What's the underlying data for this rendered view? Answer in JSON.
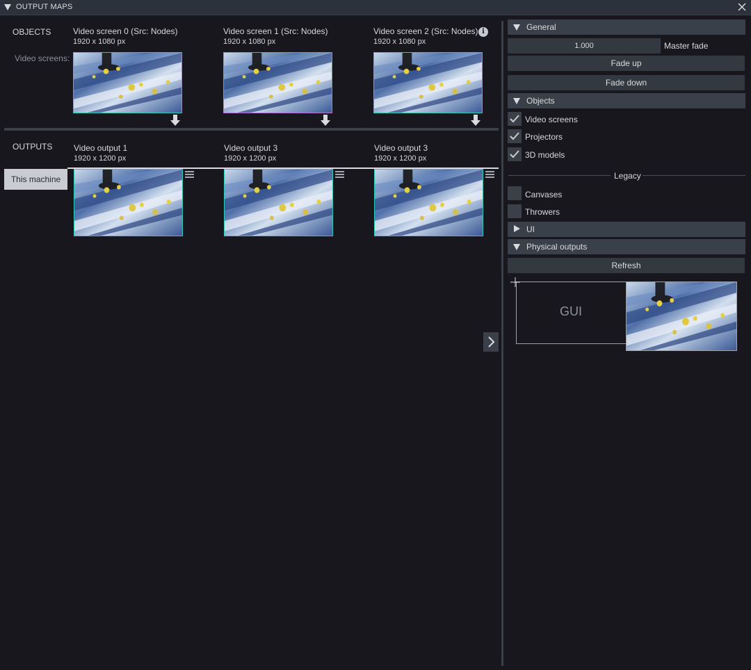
{
  "window": {
    "title": "OUTPUT MAPS"
  },
  "objects": {
    "heading": "OBJECTS",
    "row_label": "Video screens:",
    "screens": [
      {
        "name": "Video screen 0 (Src: Nodes)",
        "size": "1920 x 1080 px",
        "border": "#2fc7c0"
      },
      {
        "name": "Video screen 1 (Src: Nodes)",
        "size": "1920 x 1080 px",
        "border": "#b07ad0"
      },
      {
        "name": "Video screen 2 (Src: Nodes)",
        "size": "1920 x 1080 px",
        "border": "#2fc7c0"
      }
    ]
  },
  "outputs": {
    "heading": "OUTPUTS",
    "machine_button": "This machine",
    "items": [
      {
        "name": "Video output 1",
        "size": "1920 x 1200 px",
        "border": "#2fc7c0"
      },
      {
        "name": "Video output 3",
        "size": "1920 x 1200 px",
        "border": "#2fc7c0"
      },
      {
        "name": "Video output 3",
        "size": "1920 x 1200 px",
        "border": "#2fc7c0"
      }
    ]
  },
  "right": {
    "general": {
      "header": "General",
      "master_fade_value": "1.000",
      "master_fade_label": "Master fade",
      "fade_up": "Fade up",
      "fade_down": "Fade down"
    },
    "objects": {
      "header": "Objects",
      "items": [
        {
          "label": "Video screens",
          "checked": true
        },
        {
          "label": "Projectors",
          "checked": true
        },
        {
          "label": "3D models",
          "checked": true
        }
      ],
      "legacy_label": "Legacy",
      "legacy_items": [
        {
          "label": "Canvases",
          "checked": false
        },
        {
          "label": "Throwers",
          "checked": false
        }
      ]
    },
    "ui": {
      "header": "UI"
    },
    "physical_outputs": {
      "header": "Physical outputs",
      "refresh": "Refresh",
      "gui_label": "GUI"
    }
  },
  "icons": {
    "collapse": "triangle-down-icon",
    "close": "close-icon",
    "info": "info-icon",
    "arrow": "arrow-down-icon",
    "menu": "hamburger-menu-icon",
    "chevron": "chevron-right-icon",
    "check": "checkmark-icon"
  },
  "colors": {
    "background": "#17171d",
    "header_bg": "#3a404a",
    "button_bg": "#333941",
    "accent_teal": "#2fc7c0",
    "accent_purple": "#b07ad0"
  }
}
